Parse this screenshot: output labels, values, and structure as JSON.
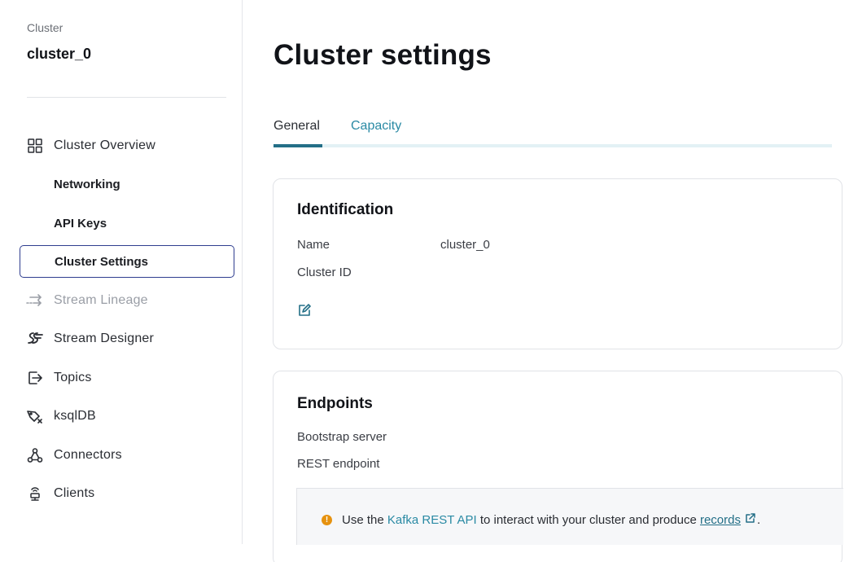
{
  "sidebar": {
    "cluster_label": "Cluster",
    "cluster_name": "cluster_0",
    "items": [
      {
        "label": "Cluster Overview",
        "icon": "grid-icon"
      },
      {
        "label": "Networking"
      },
      {
        "label": "API Keys"
      },
      {
        "label": "Cluster Settings",
        "active": true
      },
      {
        "label": "Stream Lineage",
        "icon": "lineage-arrows-icon",
        "disabled": true
      },
      {
        "label": "Stream Designer",
        "icon": "stream-designer-icon"
      },
      {
        "label": "Topics",
        "icon": "topics-icon"
      },
      {
        "label": "ksqlDB",
        "icon": "ksqldb-icon"
      },
      {
        "label": "Connectors",
        "icon": "connectors-icon"
      },
      {
        "label": "Clients",
        "icon": "clients-icon"
      }
    ]
  },
  "main": {
    "title": "Cluster settings",
    "tabs": [
      {
        "label": "General",
        "active": true
      },
      {
        "label": "Capacity"
      }
    ],
    "identification": {
      "heading": "Identification",
      "name_label": "Name",
      "name_value": "cluster_0",
      "id_label": "Cluster ID",
      "id_value": "",
      "edit_icon": "edit-icon"
    },
    "endpoints": {
      "heading": "Endpoints",
      "bootstrap_label": "Bootstrap server",
      "rest_label": "REST endpoint",
      "info": {
        "prefix": "Use the ",
        "link1": "Kafka REST API",
        "middle": " to interact with your cluster and produce ",
        "link2": "records",
        "suffix": "."
      }
    }
  },
  "colors": {
    "accent": "#236f87",
    "link": "#2a8aa4",
    "active_border": "#2f3d8f",
    "warning": "#e6920f"
  }
}
